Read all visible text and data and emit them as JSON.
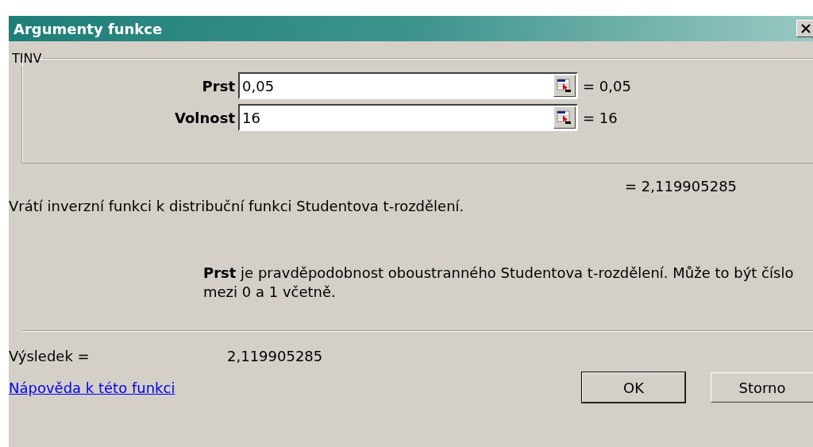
{
  "window": {
    "title": "Argumenty funkce"
  },
  "function": {
    "name": "TINV",
    "arguments": [
      {
        "label": "Prst",
        "value": "0,05",
        "result": "= 0,05"
      },
      {
        "label": "Volnost",
        "value": "16",
        "result": "= 16"
      }
    ],
    "result": "= 2,119905285",
    "description": "Vrátí inverzní funkci k distribuční funkci Studentova t-rozdělení.",
    "argument_help": {
      "name": "Prst",
      "text": "je pravděpodobnost oboustranného Studentova t-rozdělení. Může to být číslo mezi 0 a 1 včetně."
    }
  },
  "result": {
    "label": "Výsledek =",
    "value": "2,119905285"
  },
  "help_link": "Nápověda k této funkci",
  "buttons": [
    "OK",
    "Storno"
  ]
}
